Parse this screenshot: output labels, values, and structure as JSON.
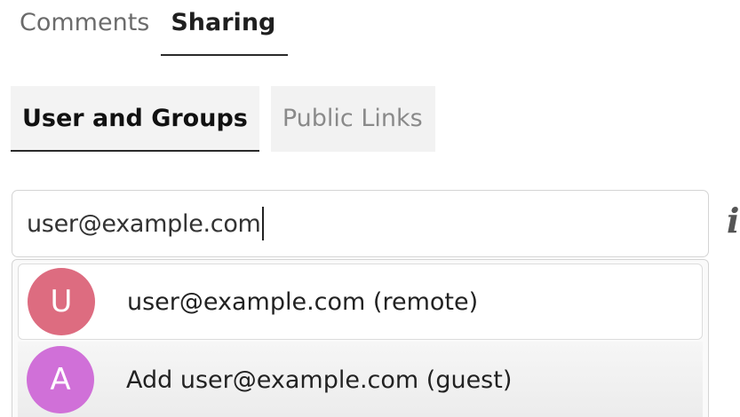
{
  "top_tabs": [
    {
      "label": "Comments",
      "active": false
    },
    {
      "label": "Sharing",
      "active": true
    }
  ],
  "sub_tabs": [
    {
      "label": "User and Groups",
      "active": true
    },
    {
      "label": "Public Links",
      "active": false
    }
  ],
  "search": {
    "value": "user@example.com"
  },
  "info_icon": "info-icon",
  "suggestions": [
    {
      "initial": "U",
      "label": "user@example.com (remote)",
      "avatar_color": "#dd6c80"
    },
    {
      "initial": "A",
      "label": "Add user@example.com (guest)",
      "avatar_color": "#d070d8"
    }
  ]
}
